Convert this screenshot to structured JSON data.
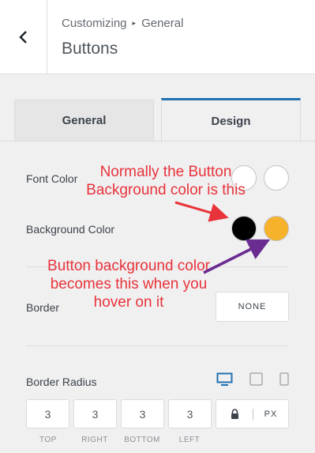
{
  "header": {
    "breadcrumb_root": "Customizing",
    "breadcrumb_sep": "▸",
    "breadcrumb_section": "General",
    "title": "Buttons"
  },
  "tabs": [
    {
      "label": "General",
      "active": false
    },
    {
      "label": "Design",
      "active": true
    }
  ],
  "font_color": {
    "label": "Font Color",
    "normal": "#ffffff",
    "hover": "#ffffff"
  },
  "background_color": {
    "label": "Background Color",
    "normal": "#000000",
    "hover": "#f6b22a"
  },
  "border": {
    "label": "Border",
    "value": "NONE"
  },
  "border_radius": {
    "label": "Border Radius",
    "values": [
      "3",
      "3",
      "3",
      "3"
    ],
    "sides": [
      "TOP",
      "RIGHT",
      "BOTTOM",
      "LEFT"
    ],
    "unit": "PX"
  },
  "annotations": {
    "normal": "Normally the Button Background color is this",
    "hover": "Button background color becomes this when you hover on it"
  },
  "colors": {
    "accent": "#2271b1",
    "annotation_text": "#e8333a",
    "arrow_red": "#e8333a",
    "arrow_purple": "#6a2c91"
  }
}
